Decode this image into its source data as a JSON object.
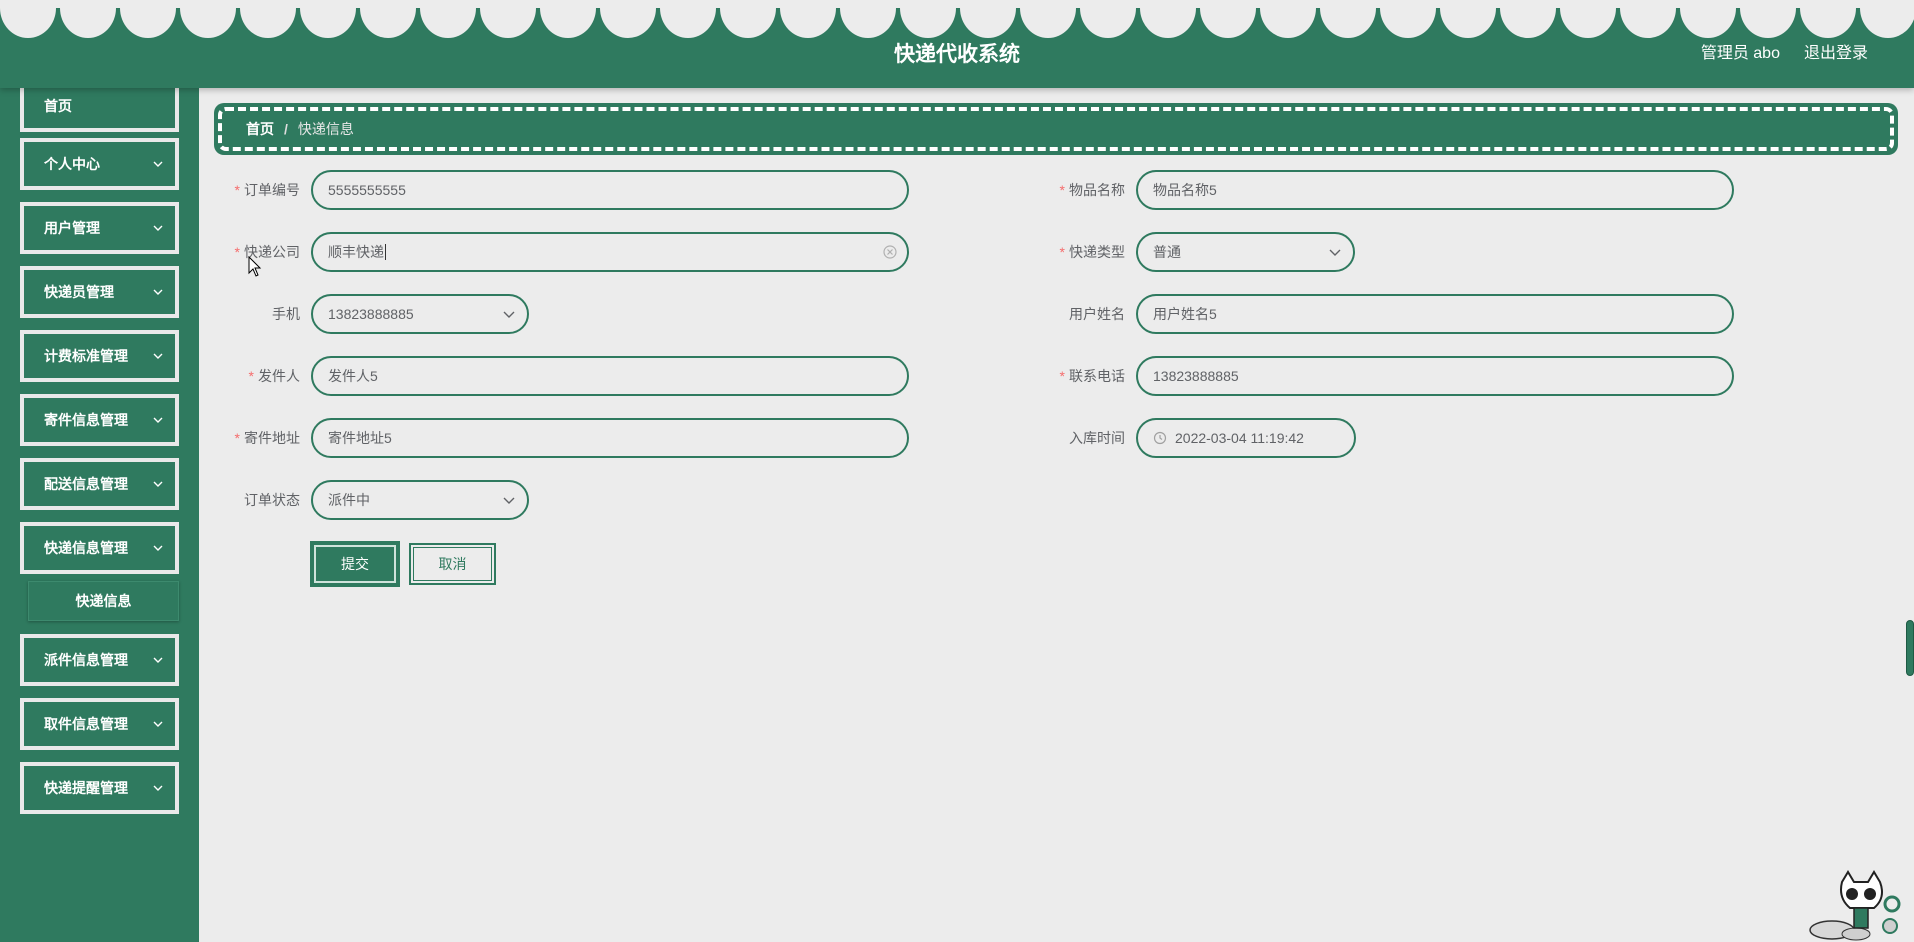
{
  "header": {
    "title": "快递代收系统",
    "user_label": "管理员 abo",
    "logout_label": "退出登录"
  },
  "sidebar": {
    "items": [
      {
        "label": "首页"
      },
      {
        "label": "个人中心"
      },
      {
        "label": "用户管理"
      },
      {
        "label": "快递员管理"
      },
      {
        "label": "计费标准管理"
      },
      {
        "label": "寄件信息管理"
      },
      {
        "label": "配送信息管理"
      },
      {
        "label": "快递信息管理"
      },
      {
        "label": "派件信息管理"
      },
      {
        "label": "取件信息管理"
      },
      {
        "label": "快递提醒管理"
      }
    ],
    "sub_item": {
      "label": "快递信息"
    }
  },
  "breadcrumb": {
    "home": "首页",
    "separator": "/",
    "current": "快递信息"
  },
  "form": {
    "order_no": {
      "label": "订单编号",
      "value": "5555555555"
    },
    "item_name": {
      "label": "物品名称",
      "value": "物品名称5"
    },
    "company": {
      "label": "快递公司",
      "value": "顺丰快递"
    },
    "express_type": {
      "label": "快递类型",
      "value": "普通"
    },
    "phone": {
      "label": "手机",
      "value": "13823888885"
    },
    "user_name": {
      "label": "用户姓名",
      "value": "用户姓名5"
    },
    "sender": {
      "label": "发件人",
      "value": "发件人5"
    },
    "contact_phone": {
      "label": "联系电话",
      "value": "13823888885"
    },
    "send_address": {
      "label": "寄件地址",
      "value": "寄件地址5"
    },
    "storage_time": {
      "label": "入库时间",
      "value": "2022-03-04 11:19:42"
    },
    "order_status": {
      "label": "订单状态",
      "value": "派件中"
    },
    "required_mark": "*",
    "submit_label": "提交",
    "cancel_label": "取消"
  },
  "colors": {
    "primary": "#2f7a5f",
    "background": "#ececec",
    "required": "#f56c6c"
  }
}
